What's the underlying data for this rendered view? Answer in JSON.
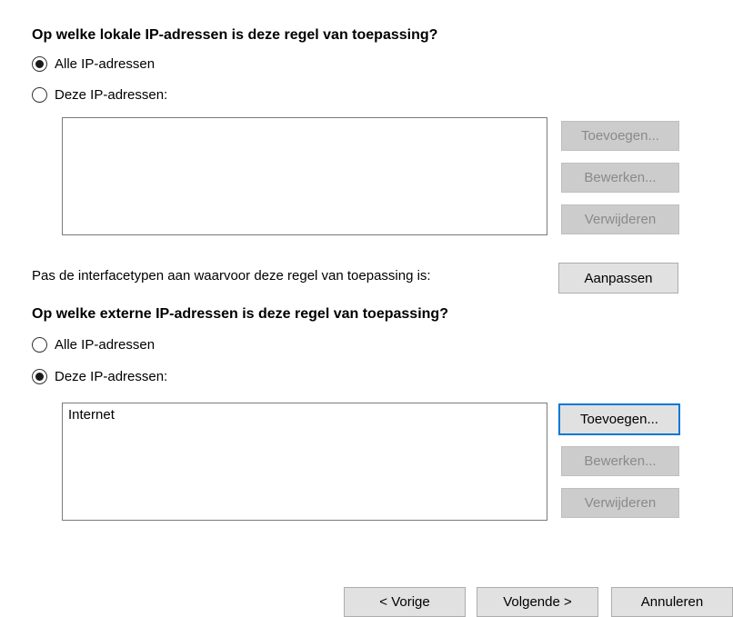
{
  "local": {
    "heading": "Op welke lokale IP-adressen is deze regel van toepassing?",
    "option_all": "Alle IP-adressen",
    "option_these": "Deze IP-adressen:",
    "selected": "all",
    "list_items": [],
    "add_label": "Toevoegen...",
    "edit_label": "Bewerken...",
    "remove_label": "Verwijderen"
  },
  "interface": {
    "text": "Pas de interfacetypen aan waarvoor deze regel van toepassing is:",
    "customize_label": "Aanpassen"
  },
  "remote": {
    "heading": "Op welke externe IP-adressen is deze regel van toepassing?",
    "option_all": "Alle IP-adressen",
    "option_these": "Deze IP-adressen:",
    "selected": "these",
    "list_items": [
      "Internet"
    ],
    "add_label": "Toevoegen...",
    "edit_label": "Bewerken...",
    "remove_label": "Verwijderen"
  },
  "footer": {
    "back_label": "< Vorige",
    "next_label": "Volgende >",
    "cancel_label": "Annuleren"
  },
  "colors": {
    "focus_border": "#0078d7",
    "button_bg": "#e1e1e1",
    "disabled_text": "#8a8a8a"
  }
}
